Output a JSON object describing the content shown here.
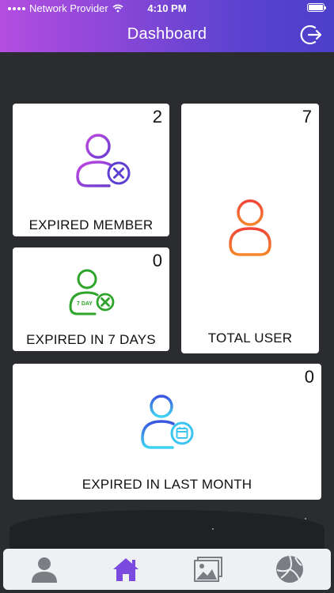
{
  "status_bar": {
    "carrier": "Network Provider",
    "time": "4:10 PM"
  },
  "header": {
    "title": "Dashboard"
  },
  "cards": {
    "expired_member": {
      "label": "EXPIRED MEMBER",
      "count": "2",
      "icon": "user-remove-icon"
    },
    "total_user": {
      "label": "TOTAL USER",
      "count": "7",
      "icon": "user-icon"
    },
    "expired_7_days": {
      "label": "EXPIRED IN 7 DAYS",
      "count": "0",
      "icon": "user-7day-expire-icon",
      "badge_text": "7 DAY"
    },
    "expired_last_month": {
      "label": "EXPIRED IN LAST MONTH",
      "count": "0",
      "icon": "user-calendar-icon"
    }
  },
  "bottom_nav": {
    "items": [
      {
        "name": "profile",
        "icon": "person-icon",
        "active": false
      },
      {
        "name": "home",
        "icon": "home-icon",
        "active": true
      },
      {
        "name": "gallery",
        "icon": "image-icon",
        "active": false
      },
      {
        "name": "sports",
        "icon": "volleyball-icon",
        "active": false
      }
    ]
  },
  "colors": {
    "header_start": "#b34ee0",
    "header_end": "#4b3fc9",
    "background": "#2b2c30",
    "active_nav": "#7b4be0",
    "inactive_nav": "#7a7d82"
  }
}
